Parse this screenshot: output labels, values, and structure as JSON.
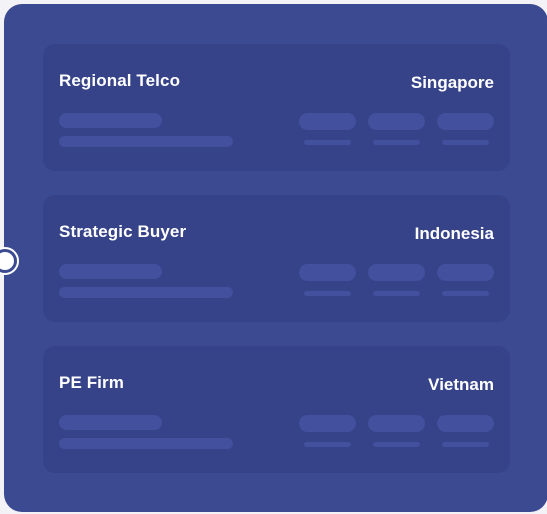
{
  "cards": [
    {
      "title": "Regional Telco",
      "location": "Singapore"
    },
    {
      "title": "Strategic Buyer",
      "location": "Indonesia"
    },
    {
      "title": "PE Firm",
      "location": "Vietnam"
    }
  ],
  "colors": {
    "panel": "#3c4a92",
    "card": "#364389",
    "skeleton": "#42509d",
    "text": "#ffffff"
  }
}
